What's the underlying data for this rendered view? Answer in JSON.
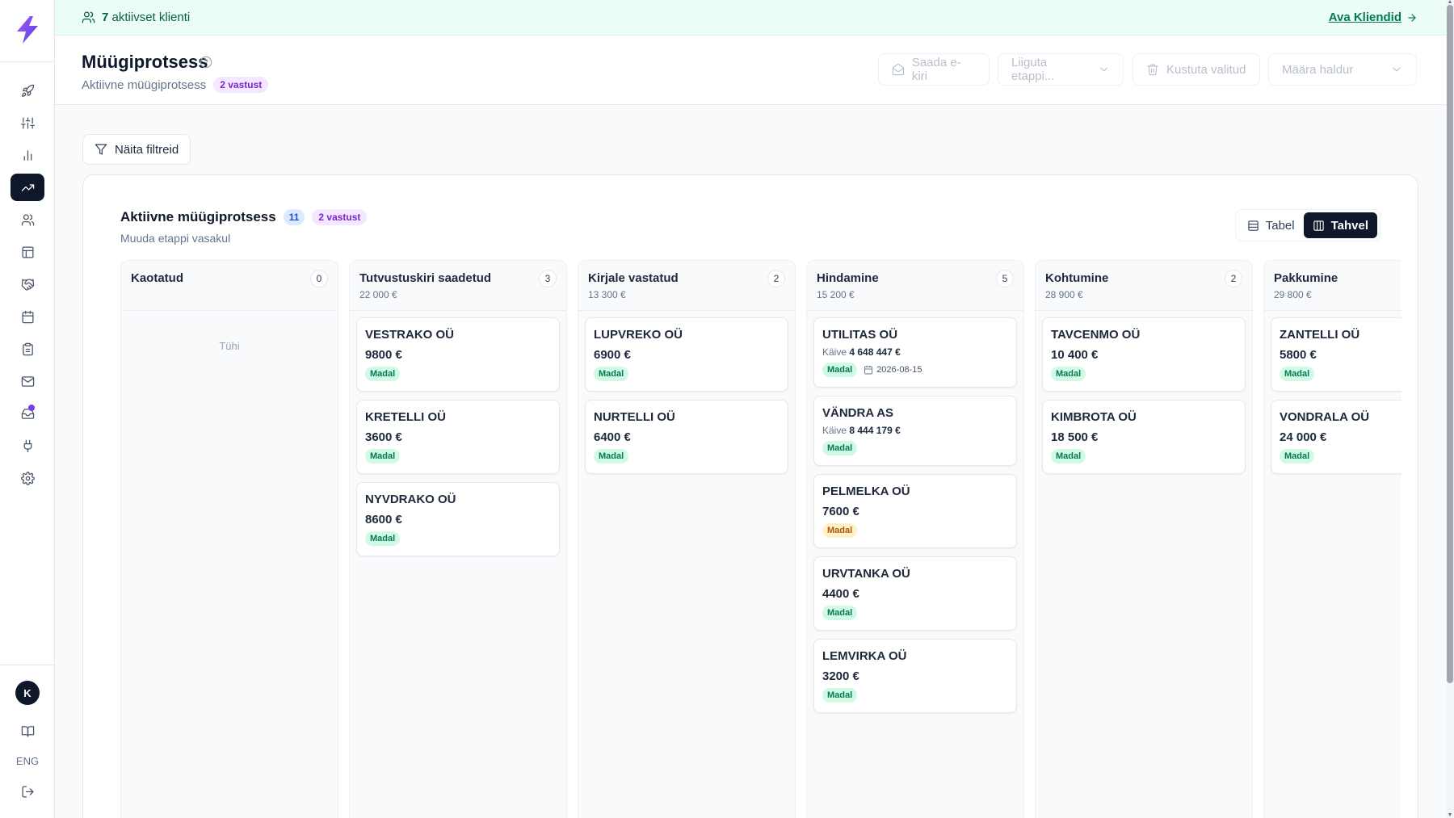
{
  "banner": {
    "count": "7",
    "text": "aktiivset klienti",
    "link": "Ava Kliendid"
  },
  "header": {
    "title": "Müügiprotsess",
    "subtitle": "Aktiivne müügiprotsess",
    "badge": "2 vastust",
    "actions": {
      "email": "Saada e-kiri",
      "move": "Liiguta etappi...",
      "delete": "Kustuta valitud",
      "assign": "Määra haldur"
    }
  },
  "filters_label": "Näita filtreid",
  "board": {
    "title": "Aktiivne müügiprotsess",
    "count": "11",
    "badge": "2 vastust",
    "subtitle": "Muuda etappi vasakul",
    "view_table": "Tabel",
    "view_board": "Tahvel",
    "empty_label": "Tühi",
    "columns": [
      {
        "name": "Kaotatud",
        "count": "0",
        "sum": "",
        "cards": []
      },
      {
        "name": "Tutvustuskiri saadetud",
        "count": "3",
        "sum": "22 000 €",
        "cards": [
          {
            "name": "VESTRAKO OÜ",
            "amount": "9800 €",
            "tag": "Madal"
          },
          {
            "name": "KRETELLI OÜ",
            "amount": "3600 €",
            "tag": "Madal"
          },
          {
            "name": "NYVDRAKO OÜ",
            "amount": "8600 €",
            "tag": "Madal"
          }
        ]
      },
      {
        "name": "Kirjale vastatud",
        "count": "2",
        "sum": "13 300 €",
        "cards": [
          {
            "name": "LUPVREKO OÜ",
            "amount": "6900 €",
            "tag": "Madal"
          },
          {
            "name": "NURTELLI OÜ",
            "amount": "6400 €",
            "tag": "Madal"
          }
        ]
      },
      {
        "name": "Hindamine",
        "count": "5",
        "sum": "15 200 €",
        "cards": [
          {
            "name": "UTILITAS OÜ",
            "meta_label": "Käive",
            "meta_value": "4 648 447 €",
            "tag": "Madal",
            "date": "2026-08-15"
          },
          {
            "name": "VÄNDRA AS",
            "meta_label": "Käive",
            "meta_value": "8 444 179 €",
            "tag": "Madal"
          },
          {
            "name": "PELMELKA OÜ",
            "amount": "7600 €",
            "tag": "Madal",
            "tag_color": "amber"
          },
          {
            "name": "URVTANKA OÜ",
            "amount": "4400 €",
            "tag": "Madal"
          },
          {
            "name": "LEMVIRKA OÜ",
            "amount": "3200 €",
            "tag": "Madal"
          }
        ]
      },
      {
        "name": "Kohtumine",
        "count": "2",
        "sum": "28 900 €",
        "cards": [
          {
            "name": "TAVCENMO OÜ",
            "amount": "10 400 €",
            "tag": "Madal"
          },
          {
            "name": "KIMBROTA OÜ",
            "amount": "18 500 €",
            "tag": "Madal"
          }
        ]
      },
      {
        "name": "Pakkumine",
        "count": "",
        "sum": "29 800 €",
        "cards": [
          {
            "name": "ZANTELLI OÜ",
            "amount": "5800 €",
            "tag": "Madal"
          },
          {
            "name": "VONDRALA OÜ",
            "amount": "24 000 €",
            "tag": "Madal"
          }
        ]
      }
    ]
  },
  "sidebar": {
    "avatar": "K",
    "lang": "ENG"
  }
}
